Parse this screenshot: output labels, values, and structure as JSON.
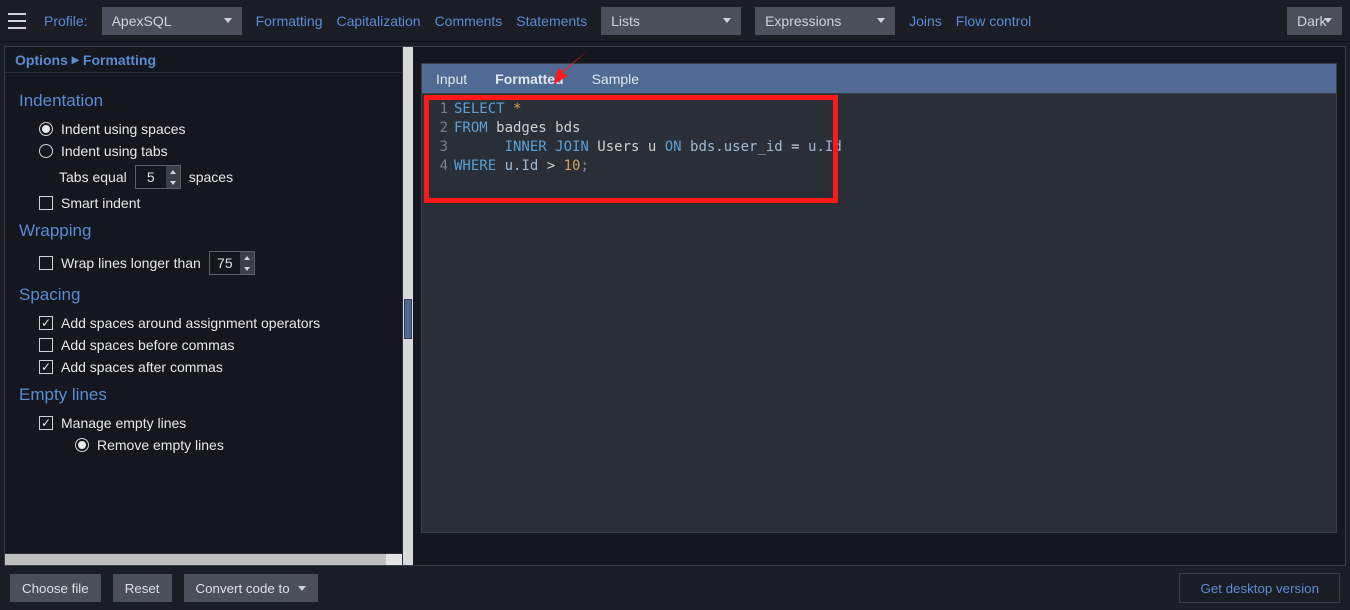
{
  "topbar": {
    "profile_label": "Profile:",
    "profile_value": "ApexSQL",
    "links": {
      "formatting": "Formatting",
      "capitalization": "Capitalization",
      "comments": "Comments",
      "statements": "Statements",
      "joins": "Joins",
      "flow": "Flow control"
    },
    "lists_value": "Lists",
    "expr_value": "Expressions",
    "theme_value": "Dark"
  },
  "breadcrumb": {
    "root": "Options",
    "current": "Formatting"
  },
  "sections": {
    "indentation": {
      "title": "Indentation",
      "spaces": "Indent using spaces",
      "tabs": "Indent using tabs",
      "tabs_equal_pre": "Tabs equal",
      "tabs_equal_val": "5",
      "tabs_equal_post": "spaces",
      "smart": "Smart indent"
    },
    "wrapping": {
      "title": "Wrapping",
      "wrap_label": "Wrap lines longer than",
      "wrap_val": "75"
    },
    "spacing": {
      "title": "Spacing",
      "around": "Add spaces around assignment operators",
      "before": "Add spaces before commas",
      "after": "Add spaces after commas"
    },
    "empty": {
      "title": "Empty lines",
      "manage": "Manage empty lines",
      "remove": "Remove empty lines"
    }
  },
  "tabs": {
    "input": "Input",
    "formatted": "Formatted",
    "sample": "Sample"
  },
  "code": {
    "l1": {
      "n": "1",
      "a": "SELECT",
      "b": " *"
    },
    "l2": {
      "n": "2",
      "a": "FROM",
      "b": " badges bds"
    },
    "l3": {
      "n": "3",
      "pad": "      ",
      "a": "INNER JOIN",
      "b": " Users u ",
      "c": "ON",
      "d": " bds.user_id ",
      "e": "=",
      "f": " u.Id"
    },
    "l4": {
      "n": "4",
      "a": "WHERE",
      "b": " u.Id ",
      "c": ">",
      "d": " ",
      "e": "10",
      "f": ";"
    }
  },
  "bottom": {
    "choose": "Choose file",
    "reset": "Reset",
    "convert": "Convert code to",
    "desktop": "Get desktop version"
  }
}
